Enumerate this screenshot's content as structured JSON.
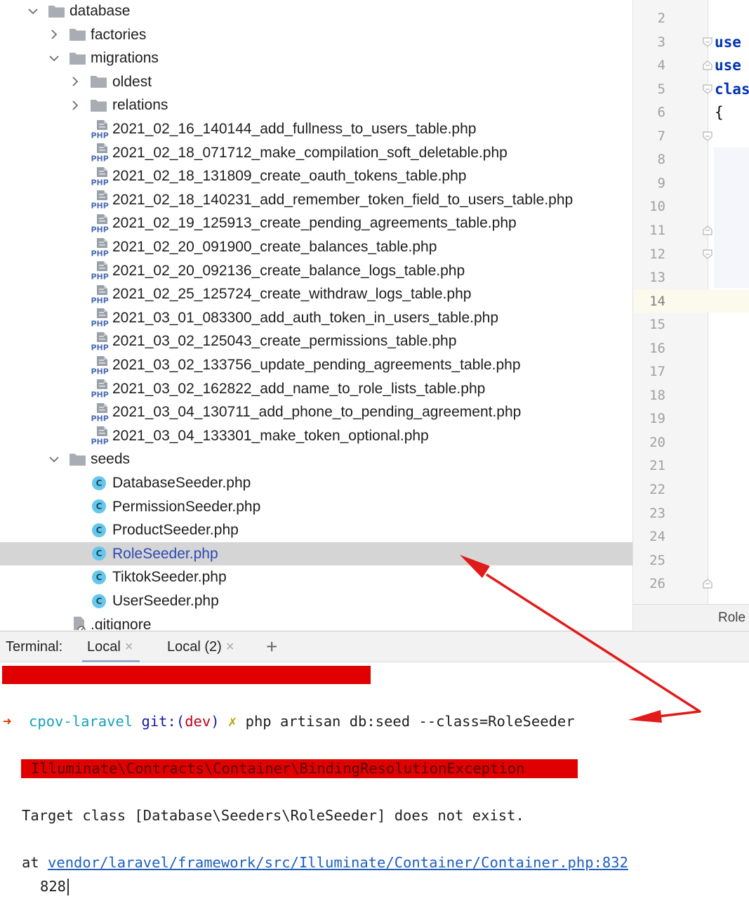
{
  "project_tree": {
    "items": [
      {
        "label": "database",
        "type": "folder",
        "expanded": true,
        "level": 1
      },
      {
        "label": "factories",
        "type": "folder",
        "expanded": false,
        "level": 2
      },
      {
        "label": "migrations",
        "type": "folder",
        "expanded": true,
        "level": 2
      },
      {
        "label": "oldest",
        "type": "folder",
        "expanded": false,
        "level": 3
      },
      {
        "label": "relations",
        "type": "folder",
        "expanded": false,
        "level": 3
      },
      {
        "label": "2021_02_16_140144_add_fullness_to_users_table.php",
        "type": "php",
        "level": 3
      },
      {
        "label": "2021_02_18_071712_make_compilation_soft_deletable.php",
        "type": "php",
        "level": 3
      },
      {
        "label": "2021_02_18_131809_create_oauth_tokens_table.php",
        "type": "php",
        "level": 3
      },
      {
        "label": "2021_02_18_140231_add_remember_token_field_to_users_table.php",
        "type": "php",
        "level": 3
      },
      {
        "label": "2021_02_19_125913_create_pending_agreements_table.php",
        "type": "php",
        "level": 3
      },
      {
        "label": "2021_02_20_091900_create_balances_table.php",
        "type": "php",
        "level": 3
      },
      {
        "label": "2021_02_20_092136_create_balance_logs_table.php",
        "type": "php",
        "level": 3
      },
      {
        "label": "2021_02_25_125724_create_withdraw_logs_table.php",
        "type": "php",
        "level": 3
      },
      {
        "label": "2021_03_01_083300_add_auth_token_in_users_table.php",
        "type": "php",
        "level": 3
      },
      {
        "label": "2021_03_02_125043_create_permissions_table.php",
        "type": "php",
        "level": 3
      },
      {
        "label": "2021_03_02_133756_update_pending_agreements_table.php",
        "type": "php",
        "level": 3
      },
      {
        "label": "2021_03_02_162822_add_name_to_role_lists_table.php",
        "type": "php",
        "level": 3
      },
      {
        "label": "2021_03_04_130711_add_phone_to_pending_agreement.php",
        "type": "php",
        "level": 3
      },
      {
        "label": "2021_03_04_133301_make_token_optional.php",
        "type": "php",
        "level": 3
      },
      {
        "label": "seeds",
        "type": "folder",
        "expanded": true,
        "level": 2
      },
      {
        "label": "DatabaseSeeder.php",
        "type": "class",
        "level": 3
      },
      {
        "label": "PermissionSeeder.php",
        "type": "class",
        "level": 3
      },
      {
        "label": "ProductSeeder.php",
        "type": "class",
        "level": 3
      },
      {
        "label": "RoleSeeder.php",
        "type": "class",
        "level": 3,
        "selected": true
      },
      {
        "label": "TiktokSeeder.php",
        "type": "class",
        "level": 3
      },
      {
        "label": "UserSeeder.php",
        "type": "class",
        "level": 3
      },
      {
        "label": ".gitignore",
        "type": "gitignore",
        "level": 2
      }
    ],
    "icon_labels": {
      "php": "PHP",
      "class": "C"
    }
  },
  "editor": {
    "line_numbers": [
      "2",
      "3",
      "4",
      "5",
      "6",
      "7",
      "8",
      "9",
      "10",
      "11",
      "12",
      "13",
      "14",
      "15",
      "16",
      "17",
      "18",
      "19",
      "20",
      "21",
      "22",
      "23",
      "24",
      "25",
      "26"
    ],
    "current_line": "14",
    "code_lines": [
      {
        "line": "3",
        "text": "use",
        "kind": "keyword"
      },
      {
        "line": "4",
        "text": "use",
        "kind": "keyword"
      },
      {
        "line": "5",
        "text": "clas",
        "kind": "keyword"
      },
      {
        "line": "6",
        "text": "{",
        "kind": "plain"
      }
    ],
    "status_tab": "Role"
  },
  "terminal": {
    "title": "Terminal:",
    "tabs": [
      {
        "label": "Local",
        "active": true
      },
      {
        "label": "Local (2)",
        "active": false
      }
    ],
    "add_label": "+",
    "close_glyph": "×",
    "prompt": {
      "arrow": "➜",
      "dir": "cpov-laravel",
      "git_prefix": "git:(",
      "branch": "dev",
      "git_suffix": ")",
      "dirty": "✗",
      "command": "php artisan db:seed --class=RoleSeeder"
    },
    "exception": "Illuminate\\Contracts\\Container\\BindingResolutionException",
    "message": "Target class [Database\\Seeders\\RoleSeeder] does not exist.",
    "at_prefix": "at",
    "at_link": "vendor/laravel/framework/src/Illuminate/Container/Container.php:832",
    "code_line_number": "828"
  },
  "colors": {
    "annotation_red": "#e11b1b",
    "redaction_red": "#e00000",
    "selection": "#d5d5d5",
    "selected_text": "#2d49b4",
    "class_icon": "#66c7ec"
  }
}
